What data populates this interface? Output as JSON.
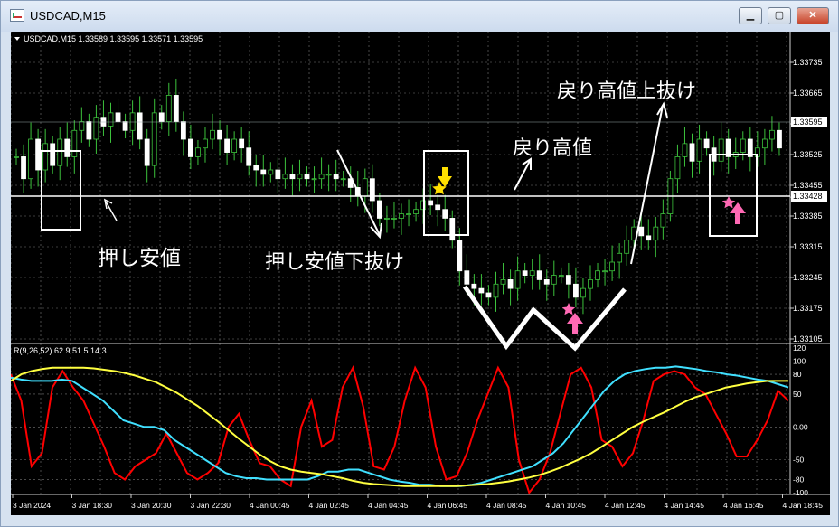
{
  "window": {
    "title": "USDCAD,M15"
  },
  "chart": {
    "info": "USDCAD,M15  1.33589 1.33595 1.33571 1.33595",
    "price_axis": [
      "1.33735",
      "1.33665",
      "1.33595",
      "1.33525",
      "1.33455",
      "1.33428",
      "1.33385",
      "1.33315",
      "1.33245",
      "1.33175",
      "1.33105"
    ],
    "current_price_label": "1.33595",
    "line_price_label": "1.33428",
    "annotations": {
      "push_low": "押し安値",
      "push_low_break": "押し安値下抜け",
      "pullback_high": "戻り高値",
      "pullback_high_break": "戻り高値上抜け"
    }
  },
  "indicator": {
    "label": "R(9,26,52) 62.9 51.5 14.3",
    "levels": [
      "120",
      "100",
      "80",
      "50",
      "0.00",
      "-50",
      "-80",
      "-100"
    ],
    "series_colors": [
      "#ff0000",
      "#40e0ff",
      "#ffff40"
    ]
  },
  "time_axis": [
    "3 Jan 2024",
    "3 Jan 18:30",
    "3 Jan 20:30",
    "3 Jan 22:30",
    "4 Jan 00:45",
    "4 Jan 02:45",
    "4 Jan 04:45",
    "4 Jan 06:45",
    "4 Jan 08:45",
    "4 Jan 10:45",
    "4 Jan 12:45",
    "4 Jan 14:45",
    "4 Jan 16:45",
    "4 Jan 18:45"
  ],
  "chart_data": {
    "type": "line",
    "x_label_note": "",
    "price_ylim": [
      1.33105,
      1.33735
    ],
    "horizontal_line": 1.33428,
    "oscillator_ylim": [
      -100,
      100
    ],
    "series": [
      {
        "name": "",
        "color": "#ff0000",
        "values": [
          80,
          40,
          -60,
          -40,
          60,
          85,
          60,
          40,
          5,
          -30,
          -70,
          -80,
          -60,
          -50,
          -40,
          -10,
          -40,
          -70,
          -80,
          -70,
          -55,
          0,
          20,
          -20,
          -55,
          -60,
          -80,
          -90,
          0,
          40,
          -30,
          -20,
          60,
          90,
          30,
          -60,
          -65,
          -30,
          40,
          90,
          60,
          -30,
          -80,
          -75,
          -40,
          10,
          50,
          90,
          60,
          -50,
          -100,
          -80,
          -40,
          20,
          80,
          90,
          60,
          -20,
          -30,
          -60,
          -40,
          10,
          70,
          80,
          85,
          80,
          60,
          50,
          20,
          -10,
          -45,
          -45,
          -20,
          10,
          55,
          40
        ]
      },
      {
        "name": "",
        "color": "#40e0ff",
        "values": [
          75,
          72,
          70,
          70,
          70,
          72,
          70,
          60,
          50,
          40,
          25,
          10,
          5,
          0,
          0,
          -5,
          -20,
          -30,
          -40,
          -50,
          -60,
          -70,
          -75,
          -78,
          -78,
          -80,
          -80,
          -80,
          -80,
          -80,
          -75,
          -68,
          -68,
          -65,
          -65,
          -70,
          -75,
          -80,
          -83,
          -85,
          -88,
          -88,
          -90,
          -90,
          -90,
          -88,
          -85,
          -80,
          -75,
          -70,
          -65,
          -60,
          -50,
          -40,
          -25,
          -5,
          15,
          35,
          55,
          70,
          80,
          85,
          88,
          90,
          90,
          92,
          90,
          88,
          85,
          83,
          80,
          78,
          75,
          72,
          70,
          65,
          60
        ]
      },
      {
        "name": "",
        "color": "#ffff40",
        "values": [
          70,
          80,
          85,
          88,
          90,
          90,
          90,
          90,
          89,
          87,
          85,
          82,
          78,
          73,
          68,
          60,
          52,
          42,
          32,
          20,
          8,
          -5,
          -18,
          -30,
          -42,
          -52,
          -60,
          -65,
          -68,
          -70,
          -72,
          -75,
          -78,
          -82,
          -85,
          -87,
          -88,
          -89,
          -90,
          -90,
          -90,
          -90,
          -90,
          -90,
          -89,
          -88,
          -87,
          -85,
          -83,
          -80,
          -77,
          -73,
          -68,
          -62,
          -55,
          -48,
          -40,
          -30,
          -20,
          -10,
          0,
          8,
          15,
          22,
          30,
          38,
          45,
          50,
          55,
          60,
          63,
          66,
          68,
          70,
          70,
          70
        ]
      }
    ]
  }
}
